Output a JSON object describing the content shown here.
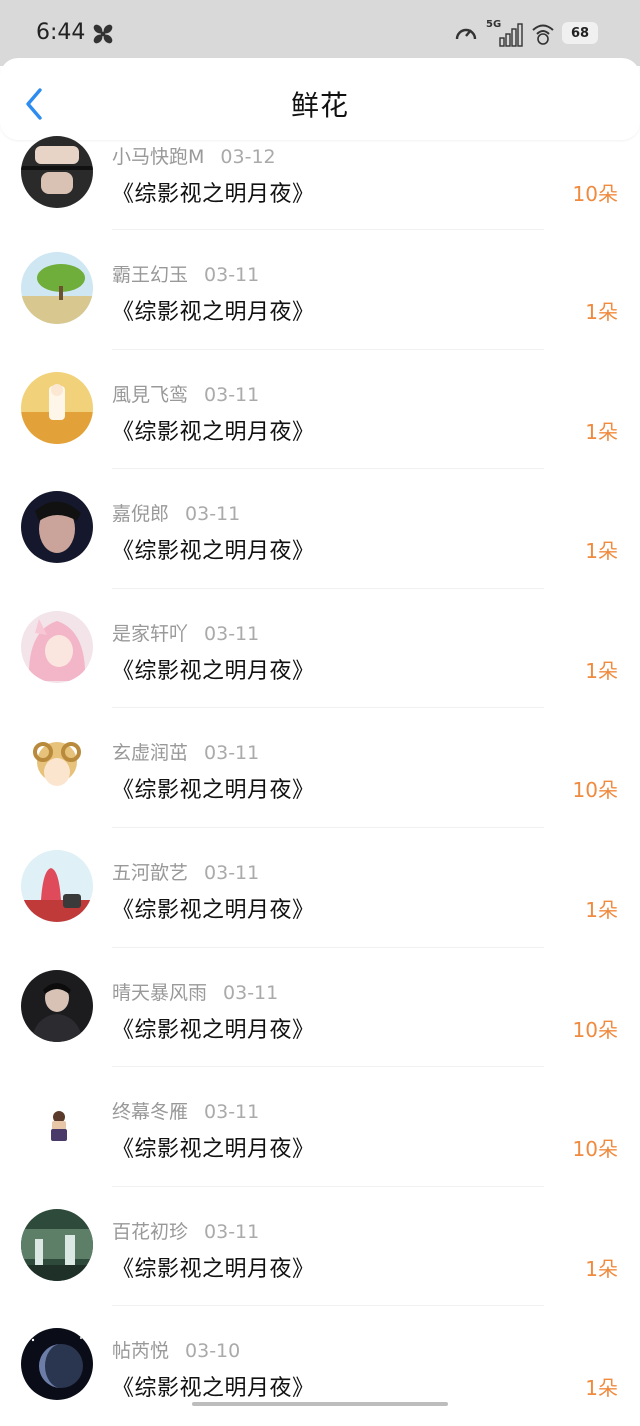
{
  "status_bar": {
    "time": "6:44",
    "network": "5G",
    "battery": "68"
  },
  "header": {
    "title": "鲜花"
  },
  "colors": {
    "accent": "#f08a3e",
    "back_icon": "#2d8cf0"
  },
  "items": [
    {
      "user": "小马快跑M",
      "date": "03-12",
      "work": "《综影视之明月夜》",
      "count": "10朵"
    },
    {
      "user": "霸王幻玉",
      "date": "03-11",
      "work": "《综影视之明月夜》",
      "count": "1朵"
    },
    {
      "user": "風見飞鸾",
      "date": "03-11",
      "work": "《综影视之明月夜》",
      "count": "1朵"
    },
    {
      "user": "嘉倪郎",
      "date": "03-11",
      "work": "《综影视之明月夜》",
      "count": "1朵"
    },
    {
      "user": "是家轩吖",
      "date": "03-11",
      "work": "《综影视之明月夜》",
      "count": "1朵"
    },
    {
      "user": "玄虚润茁",
      "date": "03-11",
      "work": "《综影视之明月夜》",
      "count": "10朵"
    },
    {
      "user": "五河歆艺",
      "date": "03-11",
      "work": "《综影视之明月夜》",
      "count": "1朵"
    },
    {
      "user": "晴天暴风雨",
      "date": "03-11",
      "work": "《综影视之明月夜》",
      "count": "10朵"
    },
    {
      "user": "终幕冬雁",
      "date": "03-11",
      "work": "《综影视之明月夜》",
      "count": "10朵"
    },
    {
      "user": "百花初珍",
      "date": "03-11",
      "work": "《综影视之明月夜》",
      "count": "1朵"
    },
    {
      "user": "帖芮悦",
      "date": "03-10",
      "work": "《综影视之明月夜》",
      "count": "1朵"
    }
  ]
}
